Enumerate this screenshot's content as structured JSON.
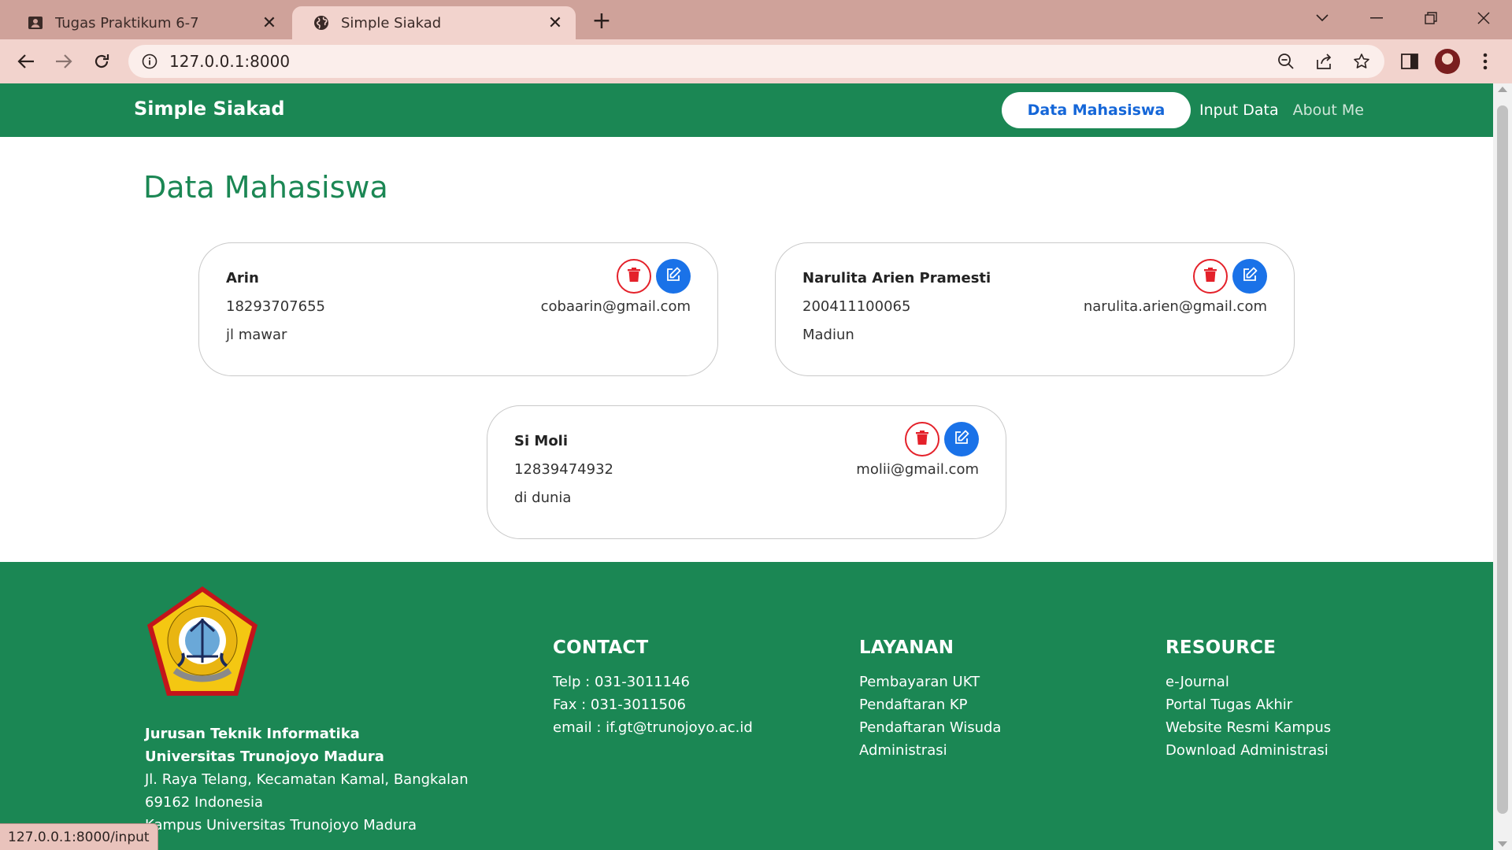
{
  "browser": {
    "tabs": [
      {
        "title": "Tugas Praktikum 6-7",
        "icon": "contact-card-icon",
        "active": false
      },
      {
        "title": "Simple Siakad",
        "icon": "globe-icon",
        "active": true
      }
    ],
    "url": "127.0.0.1:8000",
    "status_url": "127.0.0.1:8000/input"
  },
  "navbar": {
    "brand": "Simple Siakad",
    "links": [
      "Data Mahasiswa",
      "Input Data",
      "About Me"
    ],
    "active_link": "Data Mahasiswa"
  },
  "page": {
    "title": "Data Mahasiswa"
  },
  "students": [
    {
      "name": "Arin",
      "nim": "18293707655",
      "address": "jl mawar",
      "email": "cobaarin@gmail.com"
    },
    {
      "name": "Narulita Arien Pramesti",
      "nim": "200411100065",
      "address": "Madiun",
      "email": "narulita.arien@gmail.com"
    },
    {
      "name": "Si Moli",
      "nim": "12839474932",
      "address": "di dunia",
      "email": "molii@gmail.com"
    }
  ],
  "footer": {
    "org_line1": "Jurusan Teknik Informatika",
    "org_line2": "Universitas Trunojoyo Madura",
    "address_lines": [
      "Jl. Raya Telang, Kecamatan Kamal, Bangkalan",
      "69162 Indonesia",
      "Kampus Universitas Trunojoyo Madura"
    ],
    "contact": {
      "heading": "CONTACT",
      "items": [
        "Telp : 031-3011146",
        "Fax : 031-3011506",
        "email : if.gt@trunojoyo.ac.id"
      ]
    },
    "layanan": {
      "heading": "LAYANAN",
      "items": [
        "Pembayaran UKT",
        "Pendaftaran KP",
        "Pendaftaran Wisuda",
        "Administrasi"
      ]
    },
    "resource": {
      "heading": "RESOURCE",
      "items": [
        "e-Journal",
        "Portal Tugas Akhir",
        "Website Resmi Kampus",
        "Download Administrasi"
      ]
    }
  },
  "colors": {
    "brand_green": "#1b8754",
    "primary_blue": "#1a72e8",
    "danger_red": "#e4212a",
    "chrome_tab": "#cfa29a"
  }
}
